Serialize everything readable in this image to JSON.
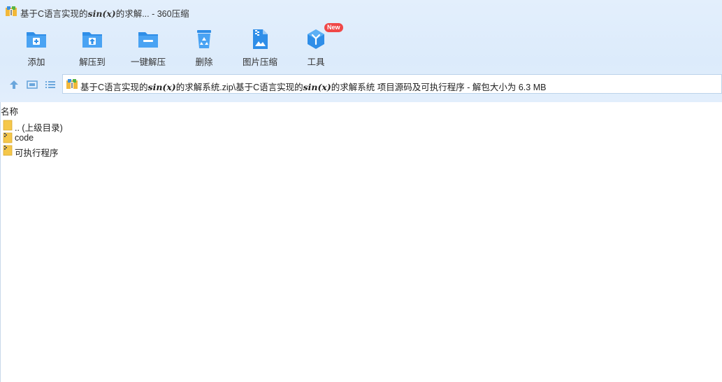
{
  "window": {
    "title_prefix": "基于C语言实现的",
    "title_math": "sin(x)",
    "title_suffix": "的求解... - 360压缩"
  },
  "toolbar": {
    "add": "添加",
    "extract_to": "解压到",
    "one_click_extract": "一键解压",
    "delete": "删除",
    "image_compress": "图片压缩",
    "tools": "工具",
    "new_badge": "New"
  },
  "path": {
    "part1": "基于C语言实现的",
    "math1": "sin(x)",
    "part2": "的求解系统.zip\\基于C语言实现的",
    "math2": "sin(x)",
    "part3": "的求解系统 项目源码及可执行程序 - 解包大小为 6.3 MB"
  },
  "columns": {
    "name": "名称"
  },
  "files": [
    {
      "name": ".. (上级目录)",
      "type": "folder"
    },
    {
      "name": "code",
      "type": "file"
    },
    {
      "name": "可执行程序",
      "type": "file"
    }
  ],
  "colors": {
    "accent": "#2f8ee8",
    "folder": "#f5c74a",
    "badge": "#f04848"
  }
}
